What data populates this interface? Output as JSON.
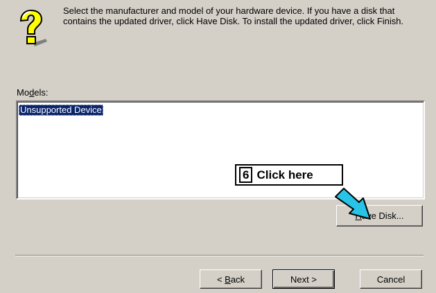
{
  "instructions": "Select the manufacturer and model of your hardware device. If you have a disk that contains the updated driver, click Have Disk. To install the updated driver, click Finish.",
  "models": {
    "label_pre": "Mo",
    "label_mnemonic": "d",
    "label_post": "els:",
    "items": [
      "Unsupported Device"
    ],
    "selected": "Unsupported Device"
  },
  "callout": {
    "number": "6",
    "text": "Click here"
  },
  "buttons": {
    "have_disk_mnemonic": "H",
    "have_disk_rest": "ave Disk...",
    "back_prefix": "< ",
    "back_mnemonic": "B",
    "back_rest": "ack",
    "next": "Next >",
    "cancel": "Cancel"
  },
  "icons": {
    "help": "help-question-icon",
    "arrow": "pointer-arrow-icon"
  },
  "colors": {
    "selection": "#0a246a",
    "arrow_fill": "#27c4e8",
    "question_yellow": "#ffff00"
  }
}
